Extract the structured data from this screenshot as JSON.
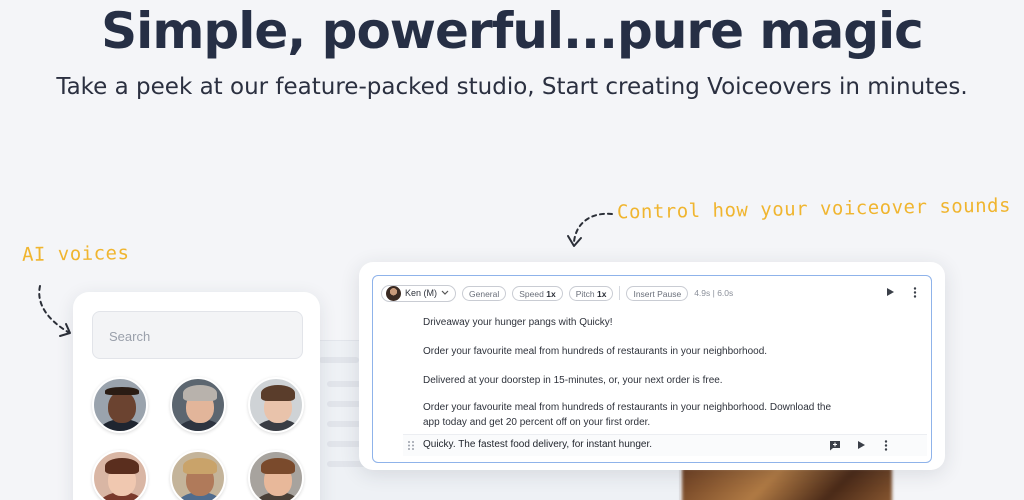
{
  "hero": {
    "title": "Simple, powerful...pure magic",
    "subtitle": "Take a peek at our feature-packed studio, Start creating Voiceovers in minutes."
  },
  "annotations": {
    "ai_voices": "AI voices",
    "control": "Control how your voiceover sounds"
  },
  "voices_panel": {
    "search_placeholder": "Search",
    "avatars": [
      {
        "name": "voice-avatar-1"
      },
      {
        "name": "voice-avatar-2"
      },
      {
        "name": "voice-avatar-3"
      },
      {
        "name": "voice-avatar-4"
      },
      {
        "name": "voice-avatar-5"
      },
      {
        "name": "voice-avatar-6"
      }
    ]
  },
  "editor": {
    "voice": "Ken (M)",
    "style": "General",
    "speed_label": "Speed",
    "speed_value": "1x",
    "pitch_label": "Pitch",
    "pitch_value": "1x",
    "insert_pause": "Insert Pause",
    "duration": "4.9s",
    "total": "6.0s",
    "paragraphs": [
      "Driveaway your hunger pangs with Quicky!",
      "Order your favourite meal from hundreds of restaurants in your neighborhood.",
      "Delivered at your doorstep in 15-minutes, or, your next order is free.",
      "Order your favourite meal from hundreds of restaurants in your neighborhood. Download the app today and get 20 percent off on your first order."
    ],
    "active_line": "Quicky. The fastest food delivery, for instant hunger."
  },
  "colors": {
    "accent": "#f0b52f",
    "title": "#262f45",
    "editor_border": "#8fb3ea"
  }
}
